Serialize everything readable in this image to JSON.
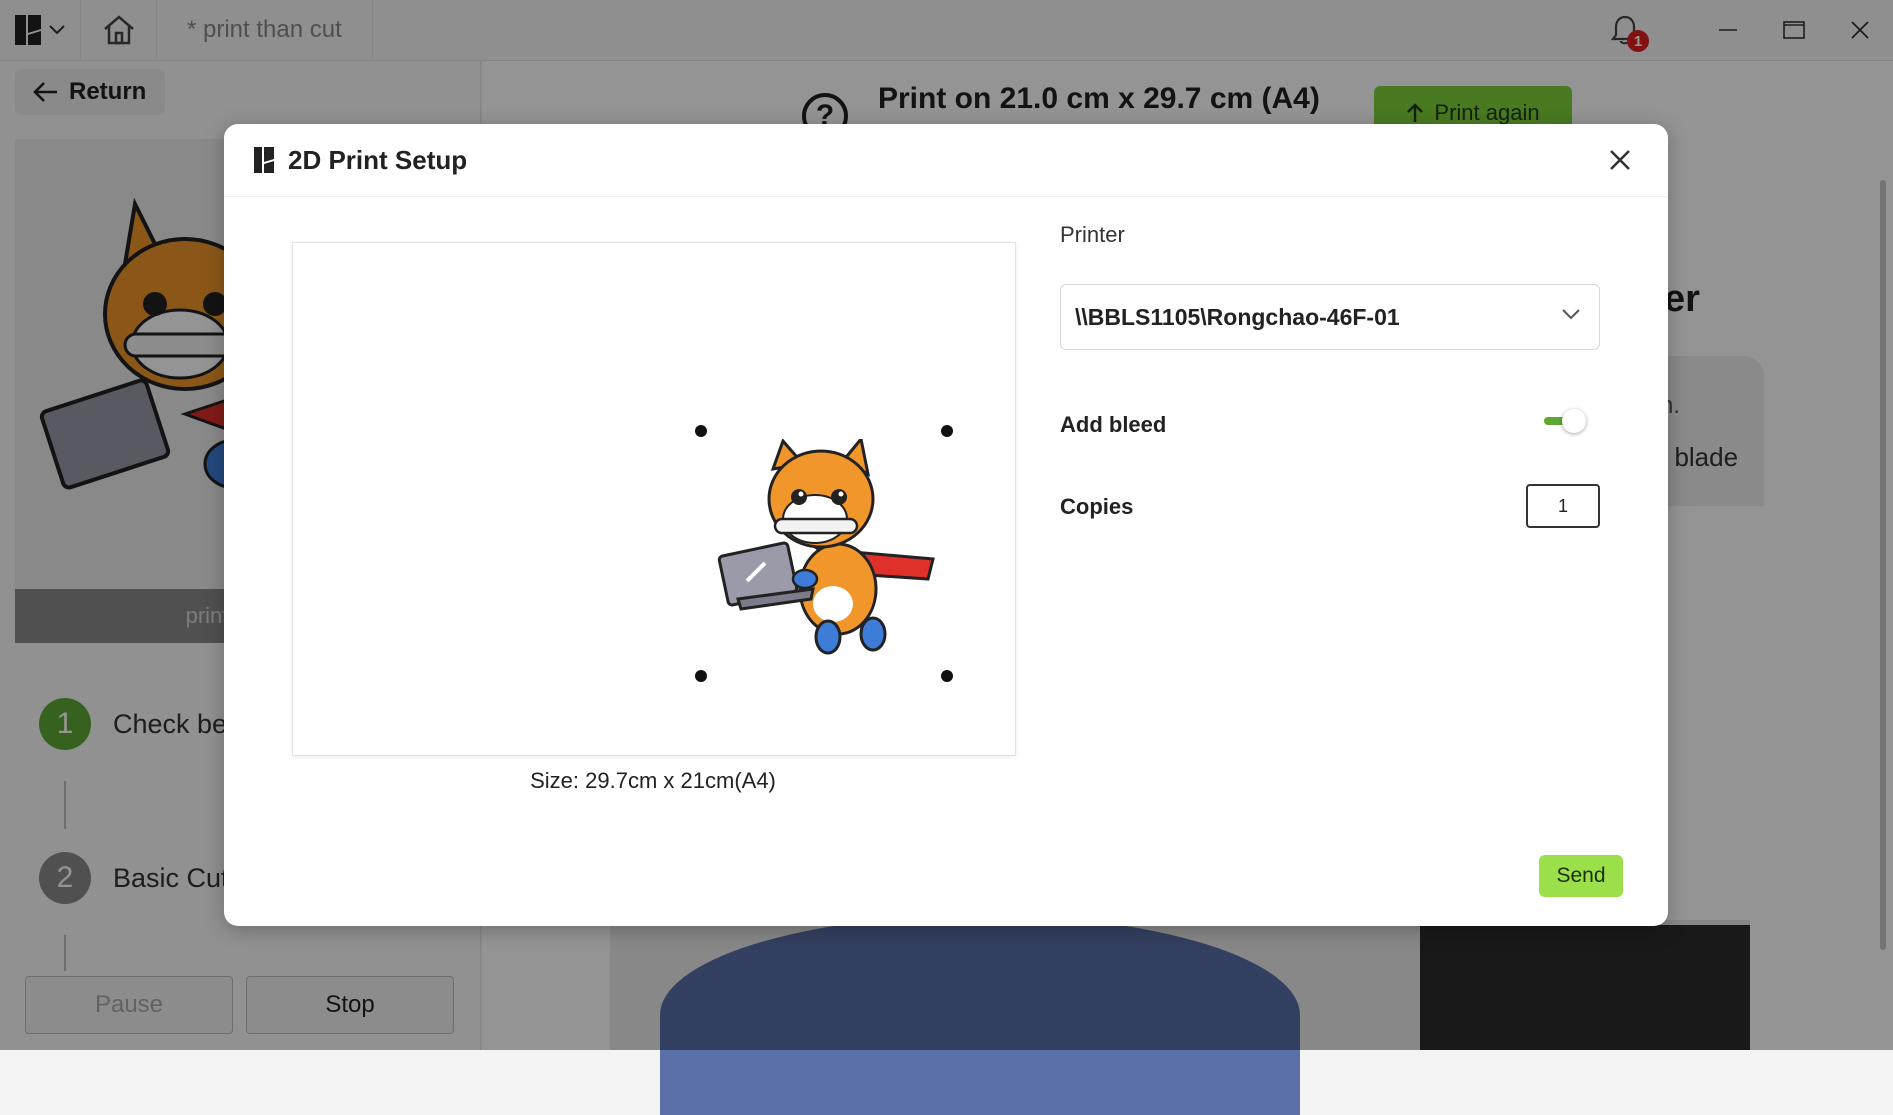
{
  "titlebar": {
    "tab_label": "* print than cut",
    "notification_count": "1"
  },
  "left_panel": {
    "return_label": "Return",
    "preview_caption": "print than c",
    "steps": [
      {
        "number": "1",
        "label": "Check bef",
        "color": "#5fa834"
      },
      {
        "number": "2",
        "label": "Basic Cut",
        "color": "#8a8a8a"
      }
    ],
    "pause_label": "Pause",
    "stop_label": "Stop"
  },
  "main": {
    "print_title": "Print on 21.0 cm x 29.7 cm (A4)",
    "help_icon": "?",
    "print_again_label": "Print again",
    "fragment_heading": "er",
    "fragment_text1": "n.",
    "fragment_text2": "t blade"
  },
  "dialog": {
    "title": "2D Print Setup",
    "size_label": "Size: 29.7cm x 21cm(A4)",
    "printer_label": "Printer",
    "printer_value": "\\\\BBLS1105\\Rongchao-46F-01",
    "add_bleed_label": "Add bleed",
    "add_bleed_enabled": true,
    "copies_label": "Copies",
    "copies_value": "1",
    "send_label": "Send"
  },
  "colors": {
    "accent_green": "#7fd33a",
    "toggle_green": "#5fa834",
    "shiba_orange": "#f0962a",
    "cape_red": "#e0302a"
  }
}
